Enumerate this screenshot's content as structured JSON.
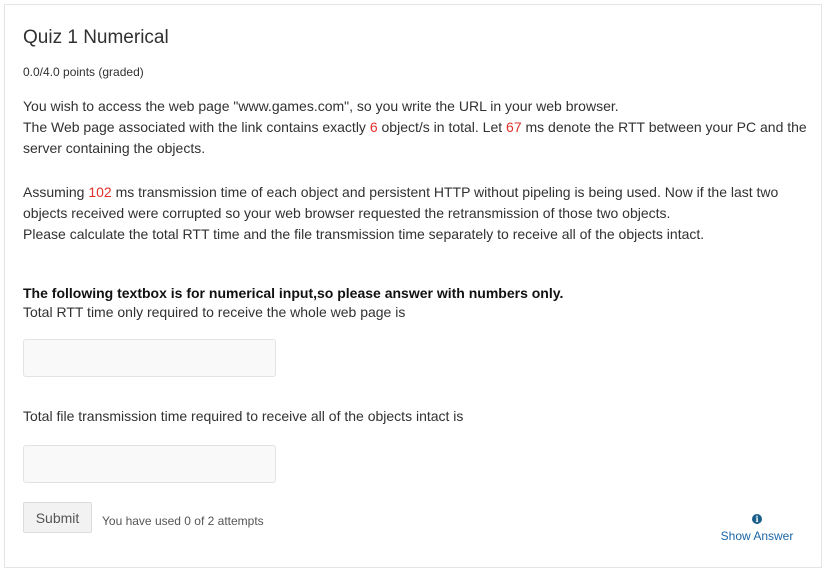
{
  "problem": {
    "title": "Quiz 1 Numerical",
    "points": "0.0/4.0 points (graded)"
  },
  "question": {
    "p1_a": "You wish to access the web page \"www.games.com\", so you write the URL in your web browser.",
    "p1_b": "The Web page associated with the link contains exactly ",
    "objects": "6",
    "p1_c": " object/s in total. Let ",
    "rtt": "67",
    "p1_d": " ms denote the RTT between your PC and the server containing the objects.",
    "p2_a": "Assuming ",
    "tx_time": "102",
    "p2_b": " ms transmission time of each object and persistent HTTP without pipeling is being used. Now if the last two objects received were corrupted so your web browser requested the retransmission of those two objects.",
    "p2_c": "Please calculate the total RTT time and the file transmission time separately to receive all of the objects intact."
  },
  "instruction": "The following textbox is for numerical input,so please answer with numbers only.",
  "field1": {
    "label": "Total RTT time only required to receive the whole web page is",
    "value": ""
  },
  "field2": {
    "label": "Total file transmission time required to receive all of the objects intact is",
    "value": ""
  },
  "actions": {
    "submit_label": "Submit",
    "attempts_text": "You have used 0 of 2 attempts",
    "show_answer_label": "Show Answer",
    "show_answer_icon": "info-icon"
  },
  "colors": {
    "highlight": "#e0312b",
    "link": "#1a66a6"
  }
}
